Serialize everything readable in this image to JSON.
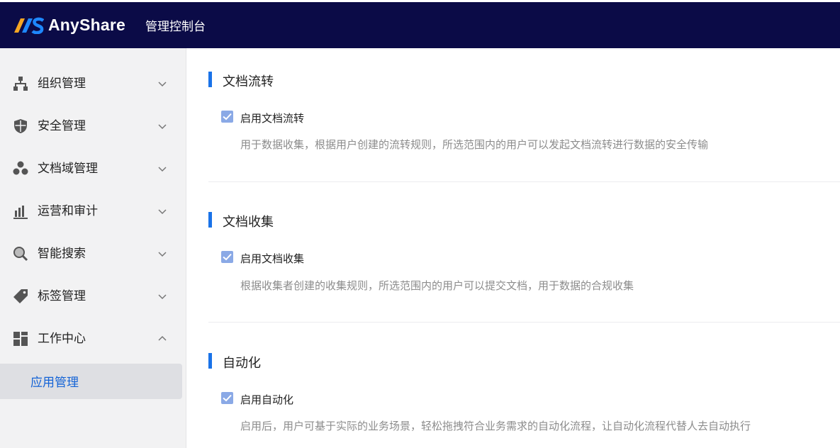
{
  "header": {
    "brand": "AnyShare",
    "console_title": "管理控制台"
  },
  "sidebar": {
    "items": [
      {
        "label": "组织管理",
        "icon": "org-chart-icon",
        "expanded": false
      },
      {
        "label": "安全管理",
        "icon": "shield-icon",
        "expanded": false
      },
      {
        "label": "文档域管理",
        "icon": "hexagon-cluster-icon",
        "expanded": false
      },
      {
        "label": "运营和审计",
        "icon": "bar-chart-icon",
        "expanded": false
      },
      {
        "label": "智能搜索",
        "icon": "magnifier-icon",
        "expanded": false
      },
      {
        "label": "标签管理",
        "icon": "tag-icon",
        "expanded": false
      },
      {
        "label": "工作中心",
        "icon": "grid-icon",
        "expanded": true
      }
    ],
    "active_sub_item": "应用管理"
  },
  "sections": [
    {
      "title": "文档流转",
      "checkbox_label": "启用文档流转",
      "checked": true,
      "description": "用于数据收集，根据用户创建的流转规则，所选范围内的用户可以发起文档流转进行数据的安全传输"
    },
    {
      "title": "文档收集",
      "checkbox_label": "启用文档收集",
      "checked": true,
      "description": "根据收集者创建的收集规则，所选范围内的用户可以提交文档，用于数据的合规收集"
    },
    {
      "title": "自动化",
      "checkbox_label": "启用自动化",
      "checked": true,
      "description": "启用后，用户可基于实际的业务场景，轻松拖拽符合业务需求的自动化流程，让自动化流程代替人去自动执行"
    }
  ],
  "colors": {
    "topbar": "#0b0b47",
    "accent": "#1a73e8",
    "checkbox": "#8aa9e6",
    "sidebar_bg": "#f2f2f3",
    "active_sub_bg": "#dedfe3"
  }
}
